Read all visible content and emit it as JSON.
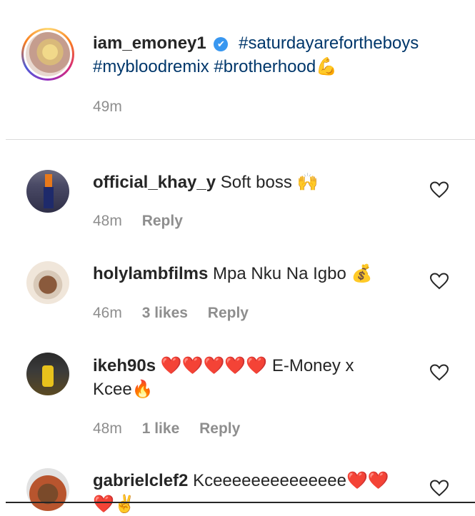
{
  "caption": {
    "username": "iam_emoney1",
    "verified": "✔",
    "tags": [
      "#saturdayarefortheboys",
      "#mybloodremix",
      "#brotherhood"
    ],
    "emoji": "💪",
    "time": "49m"
  },
  "comments": [
    {
      "username": "official_khay_y",
      "text": "Soft boss",
      "emoji": "🙌",
      "time": "48m",
      "likes": "",
      "reply": "Reply"
    },
    {
      "username": "holylambfilms",
      "text": "Mpa Nku Na Igbo",
      "emoji": "💰",
      "time": "46m",
      "likes": "3 likes",
      "reply": "Reply"
    },
    {
      "username": "ikeh90s",
      "text_pre": "❤️❤️❤️❤️❤️",
      "text": "E-Money x Kcee",
      "emoji": "🔥",
      "time": "48m",
      "likes": "1 like",
      "reply": "Reply"
    },
    {
      "username": "gabrielclef2",
      "text": "Kceeeeeeeeeeeeee",
      "emoji": "❤️❤️",
      "line2": "❤️✌️"
    }
  ],
  "colors": {
    "hashtag": "#00376b",
    "verified": "#3897f0",
    "muted": "#8e8e8e",
    "heart_fill": "#e0245e"
  },
  "icons": {
    "like": "heart-outline-icon",
    "verified": "verified-badge-icon"
  }
}
